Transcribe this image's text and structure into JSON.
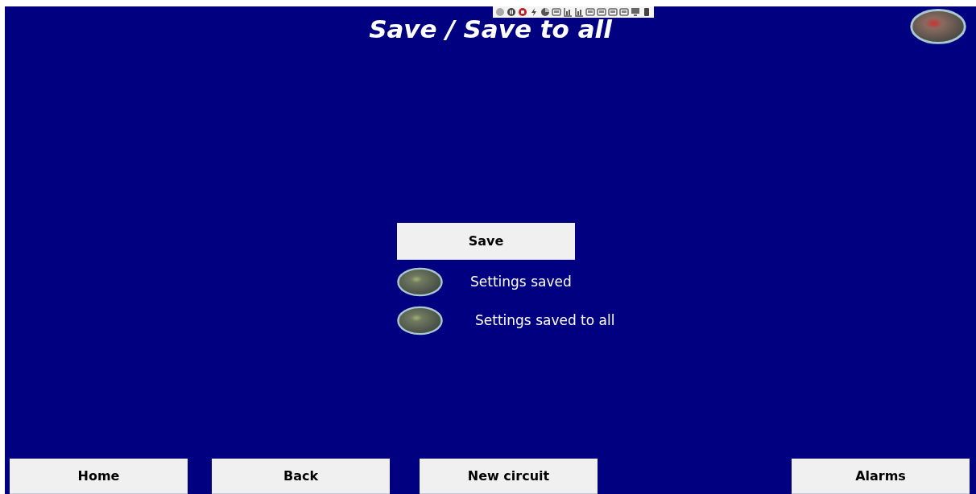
{
  "title": "Save / Save to all",
  "status_lamp": {
    "on": true
  },
  "save_button": {
    "label": "Save"
  },
  "indicators": [
    {
      "label": "Settings saved",
      "on": false
    },
    {
      "label": "Settings saved to all",
      "on": false
    }
  ],
  "nav_buttons": [
    {
      "label": "Home"
    },
    {
      "label": "Back"
    },
    {
      "label": "New circuit"
    },
    {
      "label": "Alarms"
    }
  ]
}
